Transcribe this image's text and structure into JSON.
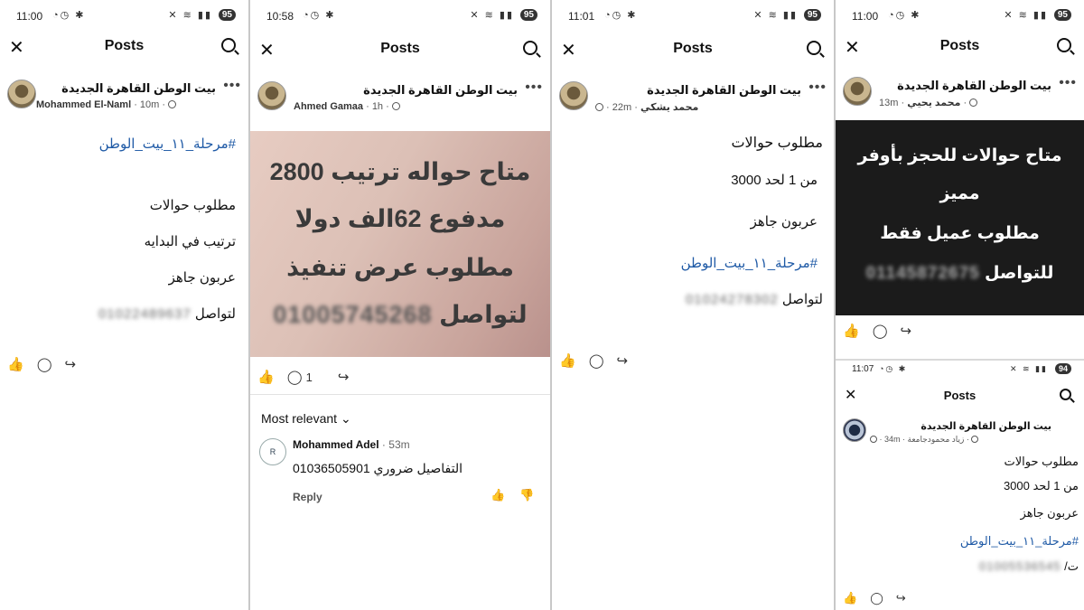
{
  "panels": [
    {
      "time": "11:00",
      "battery": "95",
      "title": "Posts",
      "group": "بيت الوطن القاهرة الجديدة",
      "author": "Mohammed El-Naml",
      "ago": "10m",
      "lines": [
        "#مرحلة_١١_بيت_الوطن",
        "مطلوب حوالات",
        "ترتيب في البدايه",
        "عربون جاهز",
        "لتواصل"
      ],
      "phone": "01022489637"
    },
    {
      "time": "10:58",
      "battery": "95",
      "title": "Posts",
      "group": "بيت الوطن القاهرة الجديدة",
      "author": "Ahmed Gamaa",
      "ago": "1h",
      "image_lines": [
        "متاح حواله ترتيب 2800",
        "مدفوع 62الف دولا",
        "مطلوب عرض تنفيذ",
        "لتواصل"
      ],
      "image_phone": "01005745268",
      "comment_count": "1",
      "sort_label": "Most relevant",
      "comment": {
        "author": "Mohammed Adel",
        "ago": "53m",
        "text": "التفاصيل ضروري 01036505901",
        "reply": "Reply"
      }
    },
    {
      "time": "11:01",
      "battery": "95",
      "title": "Posts",
      "group": "بيت الوطن القاهرة الجديدة",
      "author": "محمد يشكي",
      "ago": "22m",
      "lines": [
        "مطلوب حوالات",
        "من 1 لحد 3000",
        "عربون جاهز",
        "#مرحلة_١١_بيت_الوطن",
        "لتواصل"
      ],
      "phone": "01024278302"
    },
    {
      "time": "11:00",
      "battery": "95",
      "title": "Posts",
      "group": "بيت الوطن القاهرة الجديدة",
      "author": "محمد يحيي",
      "ago": "13m",
      "image_lines": [
        "متاح حوالات للحجز بأوفر",
        "مميز",
        "مطلوب عميل فقط",
        "للتواصل"
      ],
      "image_phone": "01145872675"
    },
    {
      "time": "11:07",
      "battery": "94",
      "title": "Posts",
      "group": "بيت الوطن القاهرة الجديدة",
      "author": "زياد محمودجامعة",
      "ago": "34m",
      "lines": [
        "مطلوب حوالات",
        "من 1 لحد 3000",
        "عربون جاهز",
        "#مرحلة_١١_بيت_الوطن",
        "ت/"
      ],
      "phone": "01005536545"
    }
  ]
}
